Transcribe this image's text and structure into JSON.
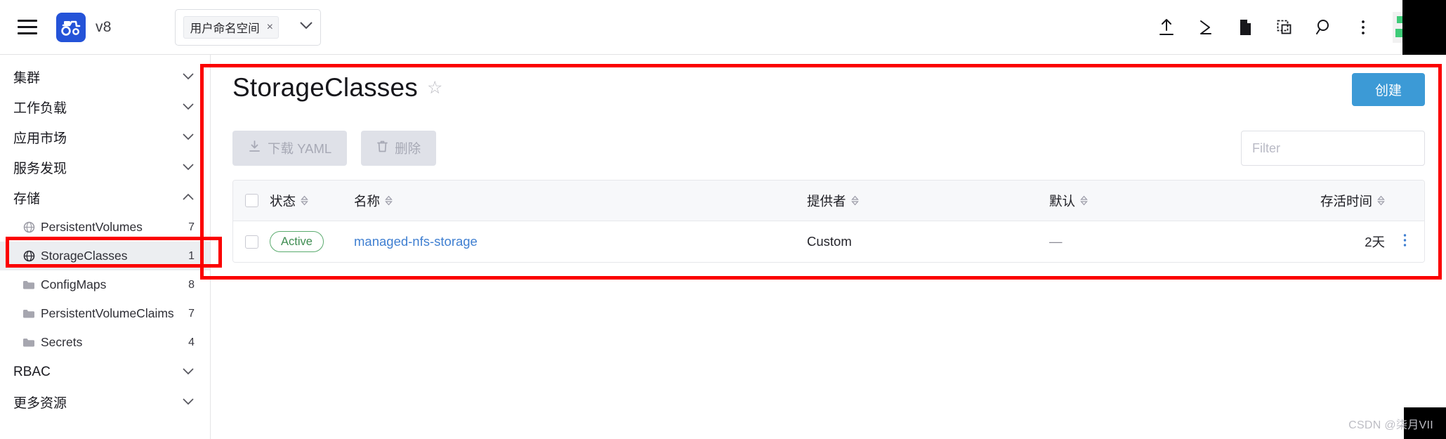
{
  "topbar": {
    "menu_label": "menu",
    "brand_version": "v8",
    "namespace": {
      "chip_label": "用户命名空间",
      "chip_remove": "×",
      "caret": "⌄"
    },
    "icons": [
      {
        "name": "upload-icon",
        "glyph": "upload"
      },
      {
        "name": "shell-icon",
        "glyph": "shell"
      },
      {
        "name": "document-icon",
        "glyph": "document"
      },
      {
        "name": "clone-icon",
        "glyph": "clone"
      },
      {
        "name": "search-icon",
        "glyph": "search"
      },
      {
        "name": "kebab-menu-icon",
        "glyph": "kebab"
      }
    ]
  },
  "sidebar": {
    "groups": [
      {
        "label": "集群",
        "chevron": "⌄",
        "expanded": false
      },
      {
        "label": "工作负载",
        "chevron": "⌄",
        "expanded": false
      },
      {
        "label": "应用市场",
        "chevron": "⌄",
        "expanded": false
      },
      {
        "label": "服务发现",
        "chevron": "⌄",
        "expanded": false
      },
      {
        "label": "存储",
        "chevron": "⌃",
        "expanded": true
      }
    ],
    "storage_children": [
      {
        "label": "PersistentVolumes",
        "count": "7",
        "icon": "globe-icon",
        "selected": false
      },
      {
        "label": "StorageClasses",
        "count": "1",
        "icon": "globe-icon",
        "selected": true
      },
      {
        "label": "ConfigMaps",
        "count": "8",
        "icon": "folder-icon",
        "selected": false
      },
      {
        "label": "PersistentVolumeClaims",
        "count": "7",
        "icon": "folder-icon",
        "selected": false
      },
      {
        "label": "Secrets",
        "count": "4",
        "icon": "folder-icon",
        "selected": false
      }
    ],
    "tail_groups": [
      {
        "label": "RBAC",
        "chevron": "⌄"
      },
      {
        "label": "更多资源",
        "chevron": "⌄"
      }
    ]
  },
  "main": {
    "title": "StorageClasses",
    "favorite_star": "☆",
    "create_button": "创建",
    "download_yaml_button": "下载 YAML",
    "delete_button": "删除",
    "filter_placeholder": "Filter",
    "filter_value": ""
  },
  "table": {
    "columns": [
      {
        "key": "status",
        "label": "状态",
        "sortable": true
      },
      {
        "key": "name",
        "label": "名称",
        "sortable": true
      },
      {
        "key": "prov",
        "label": "提供者",
        "sortable": true
      },
      {
        "key": "default",
        "label": "默认",
        "sortable": true
      },
      {
        "key": "age",
        "label": "存活时间",
        "sortable": true
      }
    ],
    "rows": [
      {
        "status": "Active",
        "name": "managed-nfs-storage",
        "prov": "Custom",
        "default": "—",
        "age": "2天",
        "kebab": "⋮"
      }
    ]
  },
  "watermark": "CSDN @柒月VII",
  "colors": {
    "annotation": "#fb0000",
    "create_button": "#3c9ad6",
    "link": "#3f7fd1",
    "badge_border": "#5aab6e",
    "badge_text": "#3f8d52",
    "brand_logo": "#2453d8",
    "avatar_green": "#3ecb78"
  }
}
